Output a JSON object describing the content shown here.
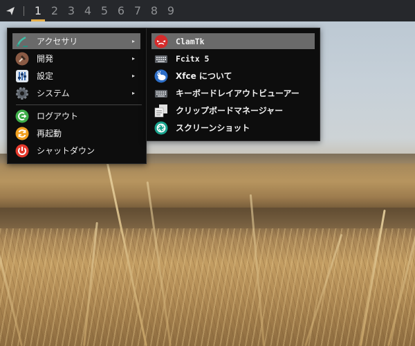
{
  "panel": {
    "launcher_icon": "paper-plane-icon",
    "workspaces": [
      {
        "label": "1",
        "active": true
      },
      {
        "label": "2"
      },
      {
        "label": "3"
      },
      {
        "label": "4"
      },
      {
        "label": "5"
      },
      {
        "label": "6"
      },
      {
        "label": "7"
      },
      {
        "label": "8"
      },
      {
        "label": "9"
      }
    ],
    "accent_color": "#e7b04a"
  },
  "main_menu": {
    "items": [
      {
        "label": "アクセサリ",
        "icon": "accessories-icon",
        "submenu": true,
        "highlighted": true
      },
      {
        "label": "開発",
        "icon": "hammer-icon",
        "submenu": true
      },
      {
        "label": "設定",
        "icon": "settings-icon",
        "submenu": true
      },
      {
        "label": "システム",
        "icon": "system-gear-icon",
        "submenu": true
      }
    ],
    "session_items": [
      {
        "label": "ログアウト",
        "icon": "logout-icon"
      },
      {
        "label": "再起動",
        "icon": "restart-icon"
      },
      {
        "label": "シャットダウン",
        "icon": "shutdown-icon"
      }
    ],
    "submenu_arrow": "▸"
  },
  "sub_menu": {
    "items": [
      {
        "label": "ClamTk",
        "icon": "clamtk-icon",
        "highlighted": true
      },
      {
        "label": "Fcitx 5",
        "icon": "keyboard-icon"
      },
      {
        "label": "Xfce について",
        "icon": "xfce-mouse-icon"
      },
      {
        "label": "キーボードレイアウトビューアー",
        "icon": "keyboard-layout-icon"
      },
      {
        "label": "クリップボードマネージャー",
        "icon": "clipboard-icon"
      },
      {
        "label": "スクリーンショット",
        "icon": "screenshot-icon"
      }
    ]
  }
}
